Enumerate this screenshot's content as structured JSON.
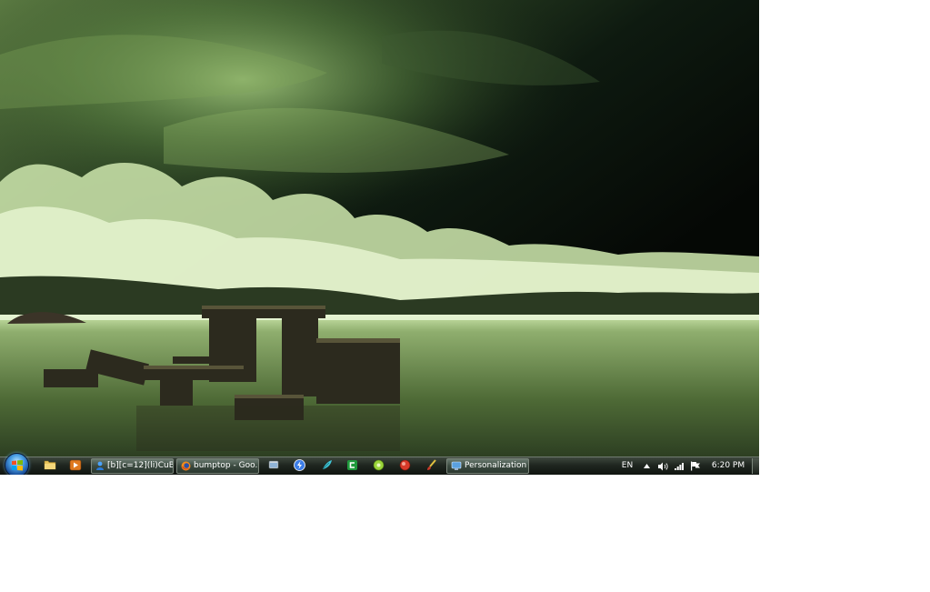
{
  "taskbar": {
    "tasks": [
      {
        "label": "[b][c=12](li)CuB..."
      },
      {
        "label": "bumptop - Goo..."
      },
      {
        "label": "Personalization"
      }
    ],
    "quick_launch": [
      {
        "icon": "folder-icon"
      },
      {
        "icon": "media-player-icon"
      }
    ],
    "pinned": [
      {
        "icon": "explorer-icon"
      },
      {
        "icon": "thunder-icon"
      },
      {
        "icon": "feather-icon"
      },
      {
        "icon": "green-app-icon"
      },
      {
        "icon": "lime-app-icon"
      },
      {
        "icon": "red-app-icon"
      },
      {
        "icon": "brush-icon"
      }
    ],
    "tray": {
      "language": "EN",
      "clock": "6:20 PM"
    }
  },
  "colors": {
    "taskbar_top": "#3d473d",
    "taskbar_bottom": "#101510",
    "wallpaper_tint": "#b8e0a0"
  }
}
